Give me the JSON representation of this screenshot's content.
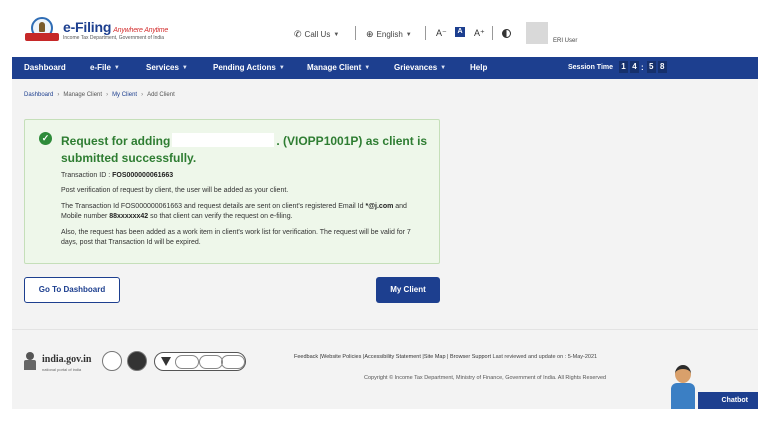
{
  "header": {
    "logo_main": "e-Filing",
    "logo_tagline": "Anywhere Anytime",
    "logo_sub": "Income Tax Department, Government of India",
    "call_us": "Call Us",
    "language": "English",
    "font_decrease": "A⁻",
    "font_normal": "A",
    "font_increase": "A⁺",
    "user_label": "ERI User"
  },
  "nav": {
    "items": [
      "Dashboard",
      "e-File",
      "Services",
      "Pending Actions",
      "Manage Client",
      "Grievances",
      "Help"
    ],
    "session_label": "Session Time",
    "session_digits": [
      "1",
      "4",
      "5",
      "8"
    ]
  },
  "breadcrumb": [
    "Dashboard",
    "Manage Client",
    "My Client",
    "Add Client"
  ],
  "success": {
    "title_prefix": "Request for adding",
    "title_suffix": ". (VIOPP1001P) as client is submitted successfully.",
    "transaction_label": "Transaction ID : ",
    "transaction_id": "FOS000000061663",
    "line1": "Post verification of request by client, the user will be added as your client.",
    "line2_a": "The Transaction Id FOS000000061663 and request details are sent on client's registered Email Id",
    "line2_email": "*@j.com",
    "line2_b": " and Mobile number ",
    "line2_mobile": "88xxxxxx42",
    "line2_c": " so that client can verify the request on e-filing.",
    "line3": "Also, the request has been added as a work item in client's work list for verification. The request will be valid for 7 days, post that Transaction Id will be expired."
  },
  "buttons": {
    "go_dashboard": "Go To Dashboard",
    "my_client": "My Client"
  },
  "footer": {
    "india_gov": "india.gov.in",
    "india_gov_sub": "national portal of india",
    "links": "Feedback |Website Policies |Accessibility Statement |Site Map | Browser Support",
    "last_reviewed": "  Last reviewed and update on : 5-May-2021",
    "copyright": "Copyright © Income Tax Department, Ministry of Finance, Government of India. All Rights Reserved"
  },
  "chatbot": "Chatbot"
}
